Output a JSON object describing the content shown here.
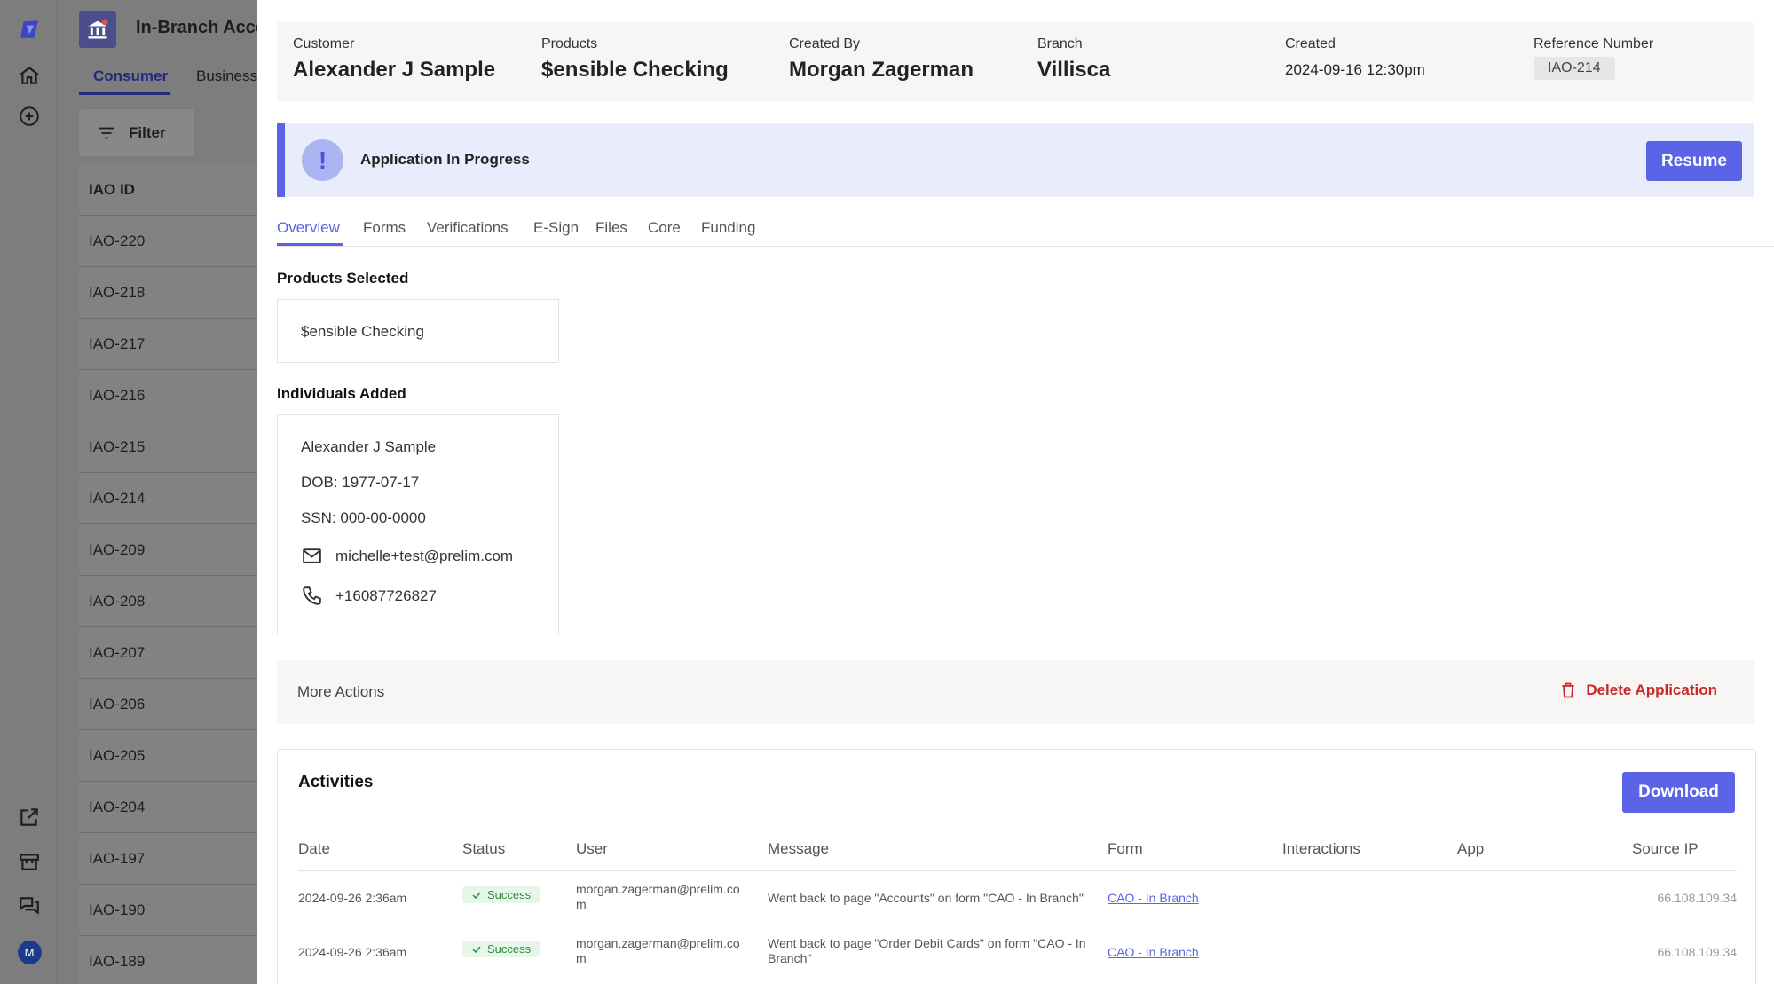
{
  "background": {
    "app_title": "In-Branch Acco",
    "tabs": [
      "Consumer",
      "Business"
    ],
    "filter_label": "Filter",
    "list_header": "IAO ID",
    "list": [
      "IAO-220",
      "IAO-218",
      "IAO-217",
      "IAO-216",
      "IAO-215",
      "IAO-214",
      "IAO-209",
      "IAO-208",
      "IAO-207",
      "IAO-206",
      "IAO-205",
      "IAO-204",
      "IAO-197",
      "IAO-190",
      "IAO-189"
    ]
  },
  "rail": {
    "avatar_initial": "M"
  },
  "summary": {
    "customer_label": "Customer",
    "customer": "Alexander J Sample",
    "products_label": "Products",
    "products": "$ensible Checking",
    "created_by_label": "Created By",
    "created_by": "Morgan Zagerman",
    "branch_label": "Branch",
    "branch": "Villisca",
    "created_label": "Created",
    "created": "2024-09-16 12:30pm",
    "reference_label": "Reference Number",
    "reference": "IAO-214"
  },
  "banner": {
    "icon": "!",
    "text": "Application In Progress",
    "resume": "Resume"
  },
  "tabs": [
    "Overview",
    "Forms",
    "Verifications",
    "E-Sign",
    "Files",
    "Core",
    "Funding"
  ],
  "products_selected": {
    "heading": "Products Selected",
    "item": "$ensible Checking"
  },
  "individuals": {
    "heading": "Individuals Added",
    "name": "Alexander J Sample",
    "dob": "DOB: 1977-07-17",
    "ssn": "SSN: 000-00-0000",
    "email": "michelle+test@prelim.com",
    "phone": "+16087726827"
  },
  "more_actions": {
    "label": "More Actions",
    "delete": "Delete Application"
  },
  "activities": {
    "title": "Activities",
    "download": "Download",
    "columns": [
      "Date",
      "Status",
      "User",
      "Message",
      "Form",
      "Interactions",
      "App",
      "Source IP"
    ],
    "rows": [
      {
        "date": "2024-09-26 2:36am",
        "status": "Success",
        "user": "morgan.zagerman@prelim.com",
        "message": "Went back to page \"Accounts\" on form \"CAO - In Branch\"",
        "form": "CAO - In Branch",
        "ip": "66.108.109.34"
      },
      {
        "date": "2024-09-26 2:36am",
        "status": "Success",
        "user": "morgan.zagerman@prelim.com",
        "message": "Went back to page \"Order Debit Cards\" on form \"CAO - In Branch\"",
        "form": "CAO - In Branch",
        "ip": "66.108.109.34"
      }
    ]
  }
}
